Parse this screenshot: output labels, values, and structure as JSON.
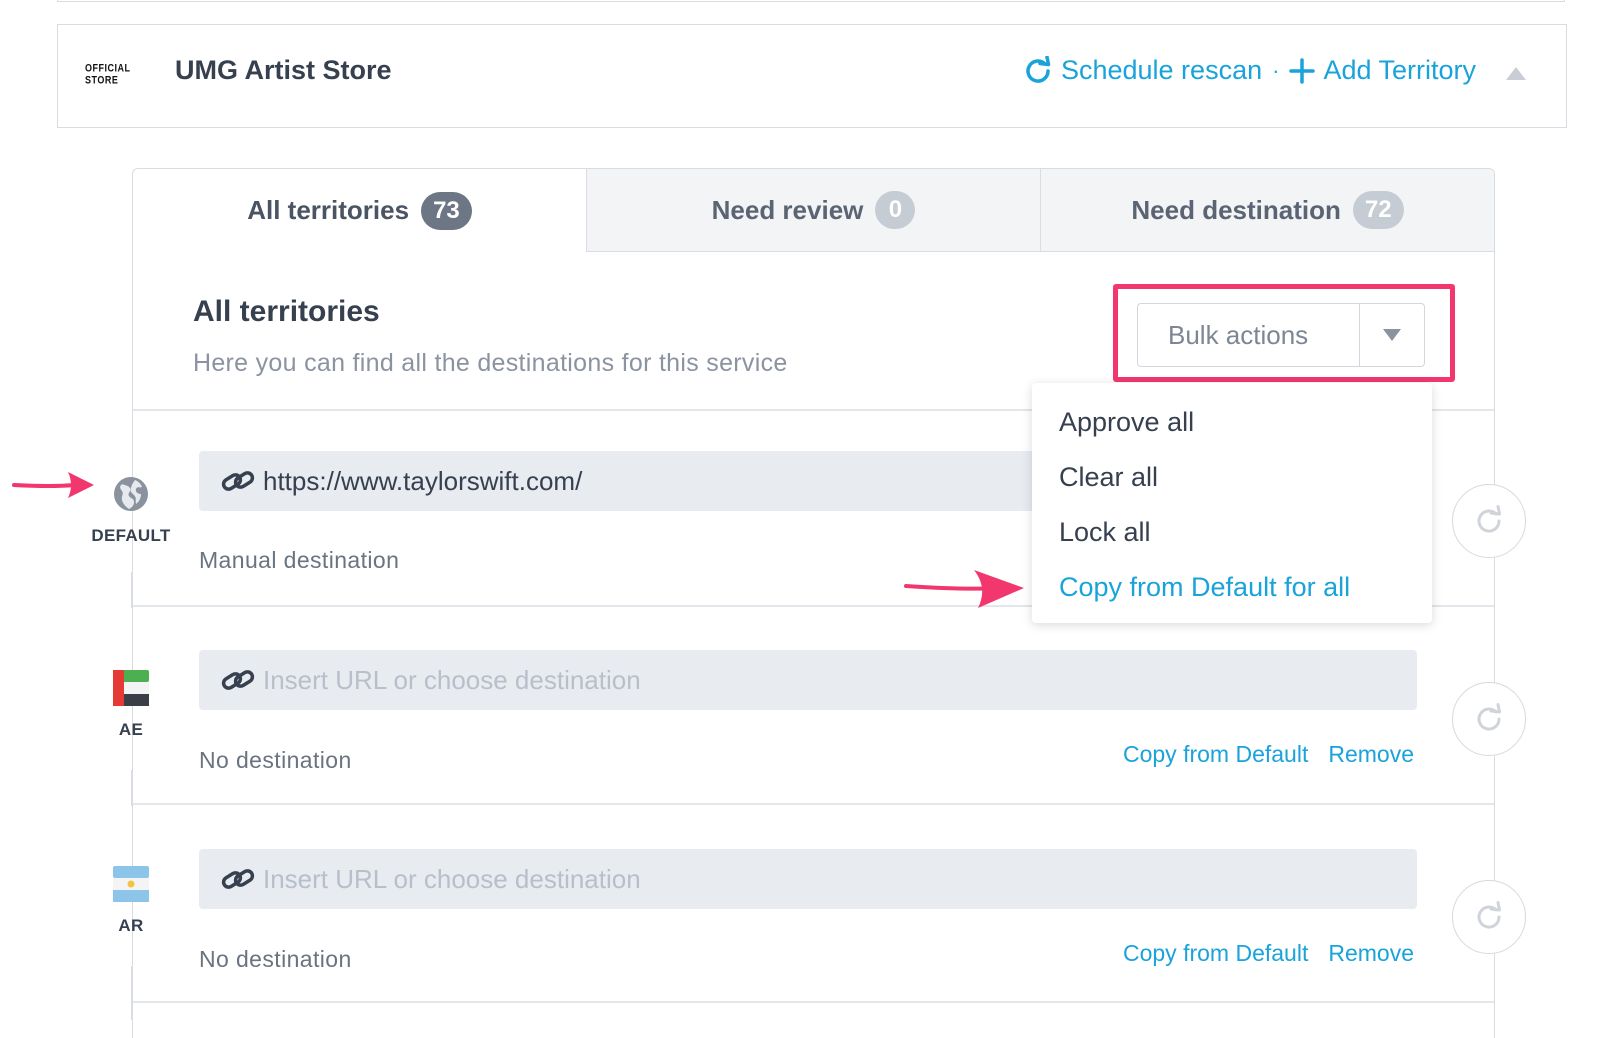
{
  "service": {
    "logo_text": "OFFICIAL STORE",
    "name": "UMG Artist Store",
    "schedule_rescan": "Schedule rescan",
    "separator": "·",
    "add_territory": "Add Territory"
  },
  "tabs": [
    {
      "label": "All territories",
      "count": "73",
      "active": true
    },
    {
      "label": "Need review",
      "count": "0",
      "active": false
    },
    {
      "label": "Need destination",
      "count": "72",
      "active": false
    }
  ],
  "section": {
    "title": "All territories",
    "subtitle": "Here you can find all the destinations for this service"
  },
  "bulk": {
    "label": "Bulk actions",
    "menu": [
      "Approve all",
      "Clear all",
      "Lock all",
      "Copy from Default for all"
    ]
  },
  "rows": [
    {
      "code": "DEFAULT",
      "url": "https://www.taylorswift.com/",
      "placeholder": "",
      "status": "Manual destination",
      "copy_label": "",
      "remove_label": ""
    },
    {
      "code": "AE",
      "url": "",
      "placeholder": "Insert URL or choose destination",
      "status": "No destination",
      "copy_label": "Copy from Default",
      "remove_label": "Remove"
    },
    {
      "code": "AR",
      "url": "",
      "placeholder": "Insert URL or choose destination",
      "status": "No destination",
      "copy_label": "Copy from Default",
      "remove_label": "Remove"
    }
  ],
  "colors": {
    "accent": "#1aa3db",
    "highlight": "#f2376f",
    "text": "#36404f"
  },
  "icons": {
    "refresh": "refresh-icon",
    "plus": "plus-icon",
    "link": "link-icon",
    "globe": "globe-icon",
    "caret": "caret-up-icon",
    "arrow": "arrow-annotation"
  }
}
